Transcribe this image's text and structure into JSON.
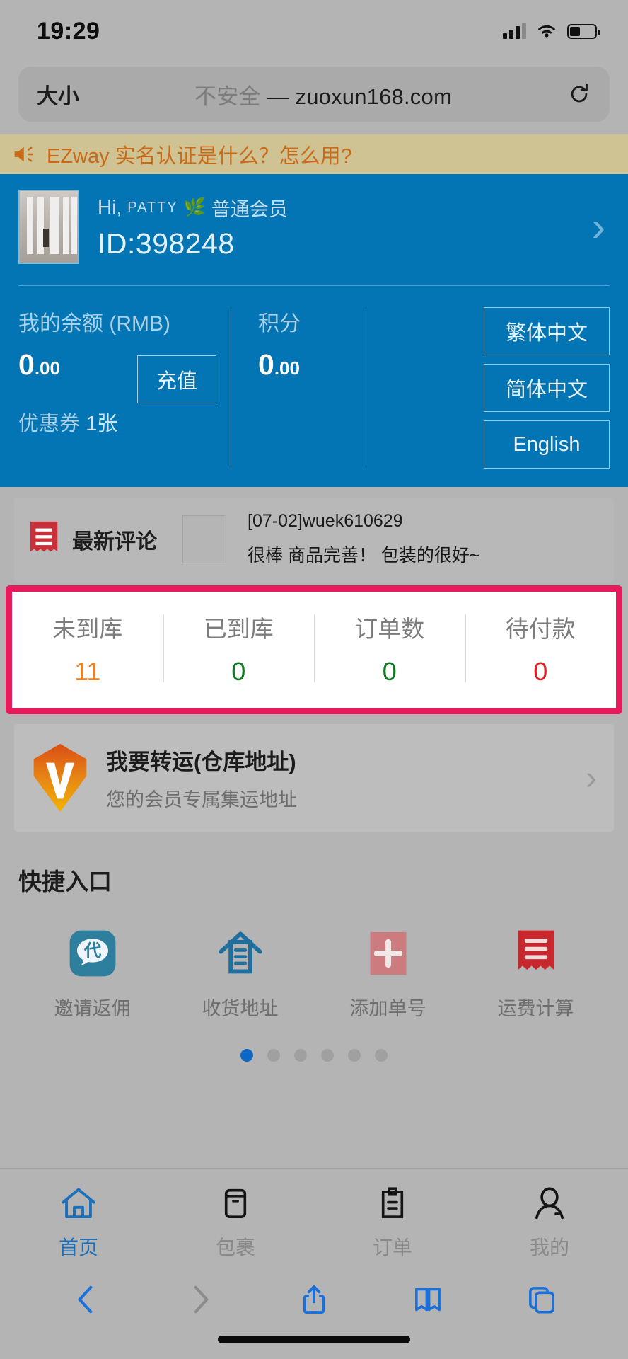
{
  "status_bar": {
    "time": "19:29",
    "signal_icon": "cellular-signal-icon",
    "wifi_icon": "wifi-icon",
    "battery_icon": "battery-icon"
  },
  "browser": {
    "size_button": "大小",
    "security_label": "不安全",
    "separator": "—",
    "domain": "zuoxun168.com",
    "reload_icon": "reload-icon",
    "toolbar": {
      "back": "back-icon",
      "forward": "forward-icon",
      "share": "share-icon",
      "bookmarks": "bookmarks-icon",
      "tabs": "tabs-icon"
    }
  },
  "announcement": {
    "icon": "megaphone-icon",
    "text": "EZway 实名认证是什么？怎么用?",
    "bg_color": "#cfc393",
    "text_color": "#c96a19"
  },
  "profile": {
    "greeting_prefix": "Hi,",
    "username": "PATTY",
    "leaf_icon": "🌿",
    "member_level": "普通会员",
    "user_id": "ID:398248",
    "chevron": "›",
    "panel_color": "#0374b4"
  },
  "wallet": {
    "balance_label": "我的余额 (RMB)",
    "balance_int": "0",
    "balance_dec": ".00",
    "topup_button": "充值",
    "points_label": "积分",
    "points_int": "0",
    "points_dec": ".00",
    "coupon_label": "优惠券",
    "coupon_count": "1张"
  },
  "languages": [
    {
      "label": "繁体中文"
    },
    {
      "label": "简体中文"
    },
    {
      "label": "English"
    }
  ],
  "review": {
    "icon": "receipt-icon",
    "title": "最新评论",
    "thumbnail": "review-thumbnail",
    "user": "[07-02]wuek610629",
    "comment": "很棒 商品完善！ 包装的很好~"
  },
  "counters": {
    "highlight_color": "#e81a5c",
    "items": [
      {
        "label": "未到库",
        "value": "11",
        "color": "#ef8021"
      },
      {
        "label": "已到库",
        "value": "0",
        "color": "#0f7a20"
      },
      {
        "label": "订单数",
        "value": "0",
        "color": "#0f7a20"
      },
      {
        "label": "待付款",
        "value": "0",
        "color": "#e02020"
      }
    ]
  },
  "forward_card": {
    "logo": "v-pin-logo-icon",
    "title": "我要转运(仓库地址)",
    "subtitle": "您的会员专属集运地址",
    "chevron": "›"
  },
  "quick_entry": {
    "title": "快捷入口",
    "items": [
      {
        "label": "邀请返佣",
        "icon": "invite-rebate-icon"
      },
      {
        "label": "收货地址",
        "icon": "delivery-address-icon"
      },
      {
        "label": "添加单号",
        "icon": "add-tracking-number-icon"
      },
      {
        "label": "运费计算",
        "icon": "shipping-calculator-icon"
      }
    ],
    "dots": {
      "total": 6,
      "active_index": 0
    }
  },
  "bottom_nav": {
    "active_color": "#1a6fb8",
    "items": [
      {
        "label": "首页",
        "icon": "home-icon",
        "active": true
      },
      {
        "label": "包裹",
        "icon": "package-icon",
        "active": false
      },
      {
        "label": "订单",
        "icon": "order-clipboard-icon",
        "active": false
      },
      {
        "label": "我的",
        "icon": "profile-person-icon",
        "active": false
      }
    ]
  }
}
